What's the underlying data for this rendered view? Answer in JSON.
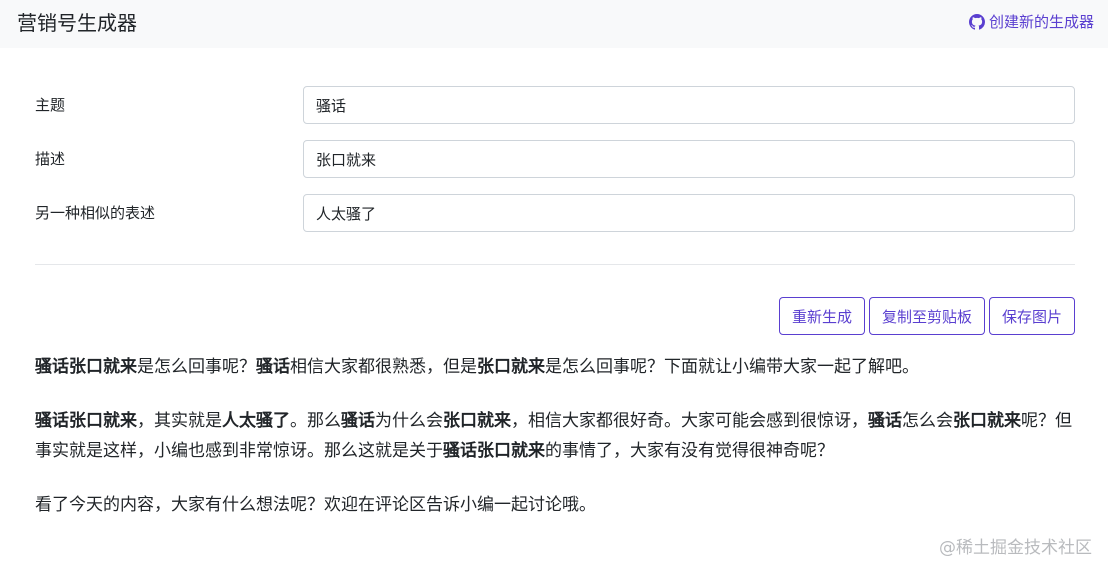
{
  "header": {
    "title": "营销号生成器",
    "repo_link": "创建新的生成器",
    "repo_icon": "github-icon"
  },
  "form": {
    "fields": [
      {
        "label": "主题",
        "value": "骚话"
      },
      {
        "label": "描述",
        "value": "张口就来"
      },
      {
        "label": "另一种相似的表述",
        "value": "人太骚了"
      }
    ]
  },
  "actions": {
    "regenerate": "重新生成",
    "copy": "复制至剪贴板",
    "save_image": "保存图片"
  },
  "article": {
    "p1": {
      "s1": "骚话张口就来",
      "s2": "是怎么回事呢？",
      "s3": "骚话",
      "s4": "相信大家都很熟悉，但是",
      "s5": "张口就来",
      "s6": "是怎么回事呢？下面就让小编带大家一起了解吧。"
    },
    "p2": {
      "s1": "骚话张口就来",
      "s2": "，其实就是",
      "s3": "人太骚了",
      "s4": "。那么",
      "s5": "骚话",
      "s6": "为什么会",
      "s7": "张口就来",
      "s8": "，相信大家都很好奇。大家可能会感到很惊讶，",
      "s9": "骚话",
      "s10": "怎么会",
      "s11": "张口就来",
      "s12": "呢？但事实就是这样，小编也感到非常惊讶。那么这就是关于",
      "s13": "骚话张口就来",
      "s14": "的事情了，大家有没有觉得很神奇呢？"
    },
    "p3": "看了今天的内容，大家有什么想法呢？欢迎在评论区告诉小编一起讨论哦。"
  },
  "watermark": "@稀土掘金技术社区",
  "colors": {
    "accent": "#5a3fd0",
    "header_bg": "#f8f9fa",
    "border": "#ced4da"
  }
}
